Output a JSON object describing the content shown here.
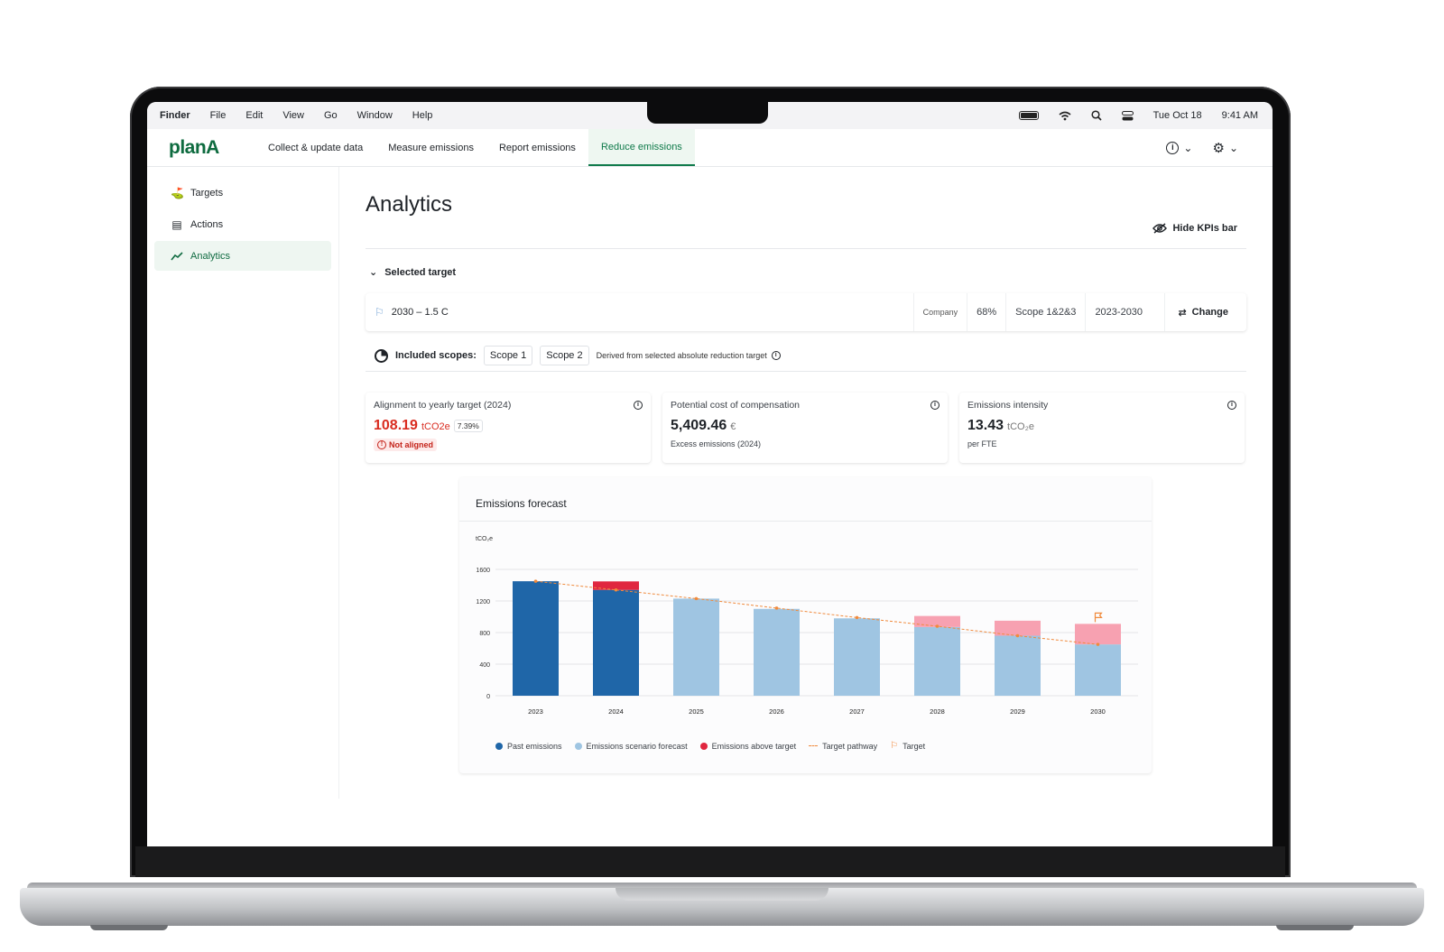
{
  "menubar": {
    "items": [
      "Finder",
      "File",
      "Edit",
      "View",
      "Go",
      "Window",
      "Help"
    ],
    "date": "Tue Oct 18",
    "time": "9:41 AM"
  },
  "app": {
    "logo": "planA",
    "tabs": [
      {
        "label": "Collect & update data",
        "active": false
      },
      {
        "label": "Measure emissions",
        "active": false
      },
      {
        "label": "Report emissions",
        "active": false
      },
      {
        "label": "Reduce emissions",
        "active": true
      }
    ]
  },
  "sidebar": {
    "items": [
      {
        "label": "Targets",
        "icon": "golf-flag-icon"
      },
      {
        "label": "Actions",
        "icon": "clipboard-icon"
      },
      {
        "label": "Analytics",
        "icon": "trend-line-icon",
        "active": true
      }
    ]
  },
  "page": {
    "title": "Analytics",
    "hide_kpis": "Hide KPIs bar",
    "selected_target_label": "Selected target",
    "target": {
      "name": "2030 – 1.5 C",
      "level": "Company",
      "reduction": "68%",
      "scopes": "Scope 1&2&3",
      "period": "2023-2030",
      "change_label": "Change"
    },
    "included_scopes_label": "Included scopes:",
    "included_scopes": [
      "Scope 1",
      "Scope 2"
    ],
    "derived_note": "Derived from selected absolute reduction target"
  },
  "kpis": [
    {
      "title": "Alignment to yearly target (2024)",
      "value": "108.19",
      "unit": "tCO2e",
      "pct": "7.39%",
      "status": "Not aligned"
    },
    {
      "title": "Potential cost of compensation",
      "value": "5,409.46",
      "unit": "€",
      "sub": "Excess emissions (2024)"
    },
    {
      "title": "Emissions intensity",
      "value": "13.43",
      "unit": "tCO₂e",
      "sub": "per FTE"
    }
  ],
  "chart": {
    "title": "Emissions forecast",
    "legend": [
      "Past emissions",
      "Emissions scenario forecast",
      "Emissions above target",
      "Target pathway",
      "Target"
    ]
  },
  "colors": {
    "past": "#1f66a8",
    "forecast": "#9fc5e2",
    "above_past": "#e0263f",
    "above_forecast": "#f7a1b1",
    "target_line": "#f08a3c",
    "accent": "#0f7a4a"
  },
  "chart_data": {
    "type": "bar",
    "title": "Emissions forecast",
    "ylabel": "tCO₂e",
    "ylim": [
      0,
      1600
    ],
    "yticks": [
      0,
      400,
      800,
      1200,
      1600
    ],
    "categories": [
      "2023",
      "2024",
      "2025",
      "2026",
      "2027",
      "2028",
      "2029",
      "2030"
    ],
    "series": [
      {
        "name": "Past emissions",
        "values": [
          1450,
          1340,
          0,
          0,
          0,
          0,
          0,
          0
        ]
      },
      {
        "name": "Emissions scenario forecast",
        "values": [
          0,
          0,
          1230,
          1100,
          980,
          870,
          760,
          650
        ]
      },
      {
        "name": "Emissions above target",
        "values": [
          0,
          108,
          0,
          0,
          0,
          140,
          190,
          260
        ]
      },
      {
        "name": "Target pathway",
        "values": [
          1450,
          1340,
          1230,
          1110,
          990,
          880,
          760,
          650
        ]
      }
    ],
    "target": {
      "category": "2030",
      "value": 650
    },
    "grid": true,
    "legend_position": "bottom"
  }
}
